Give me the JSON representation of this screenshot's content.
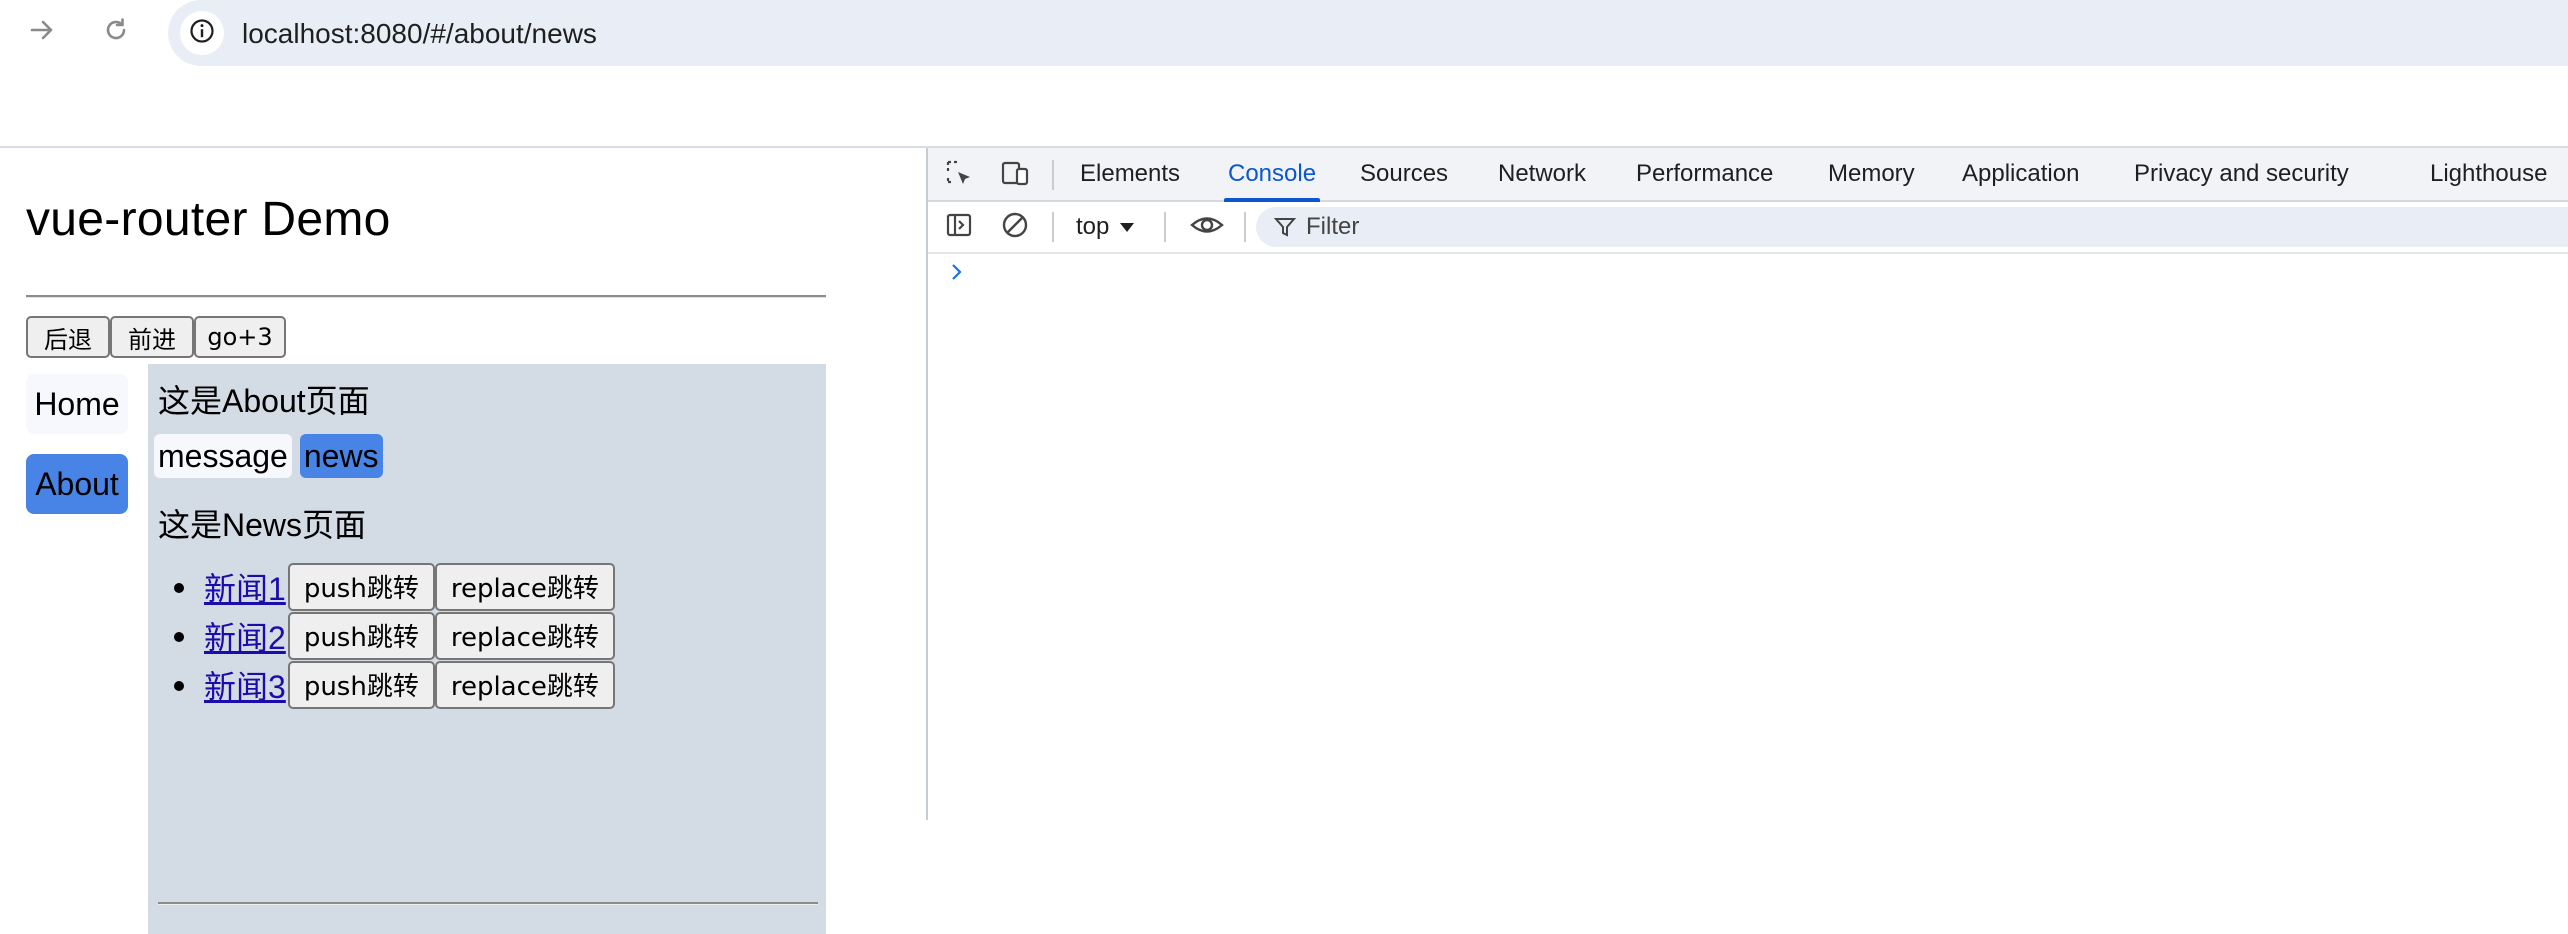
{
  "browser": {
    "url": "localhost:8080/#/about/news",
    "icons": {
      "forward": "arrow-right-icon",
      "reload": "reload-icon",
      "site_info": "info-icon"
    }
  },
  "page": {
    "title": "vue-router Demo",
    "history_buttons": {
      "back": "后退",
      "forward": "前进",
      "go3": "go+3"
    },
    "sidebar": {
      "home": "Home",
      "about": "About"
    },
    "about_text": "这是About页面",
    "tabs": {
      "message": "message",
      "news": "news"
    },
    "news_text": "这是News页面",
    "news_items": [
      {
        "label": "新闻1",
        "push": "push跳转",
        "replace": "replace跳转"
      },
      {
        "label": "新闻2",
        "push": "push跳转",
        "replace": "replace跳转"
      },
      {
        "label": "新闻3",
        "push": "push跳转",
        "replace": "replace跳转"
      }
    ],
    "colors": {
      "active_link": "#4784e5",
      "panel_bg": "#d3dbe4",
      "inactive_link": "#f6f8fe"
    }
  },
  "devtools": {
    "tabs": [
      "Elements",
      "Console",
      "Sources",
      "Network",
      "Performance",
      "Memory",
      "Application",
      "Privacy and security",
      "Lighthouse"
    ],
    "active_tab": "Console",
    "context": "top",
    "filter_placeholder": "Filter",
    "accent": "#0b57d0",
    "icons": {
      "inspect": "inspect-element-icon",
      "device": "device-toolbar-icon",
      "sidebar": "sidebar-toggle-icon",
      "clear": "clear-console-icon",
      "eye": "live-expression-eye-icon",
      "filter": "filter-icon",
      "prompt": "console-prompt-chevron-icon"
    }
  }
}
